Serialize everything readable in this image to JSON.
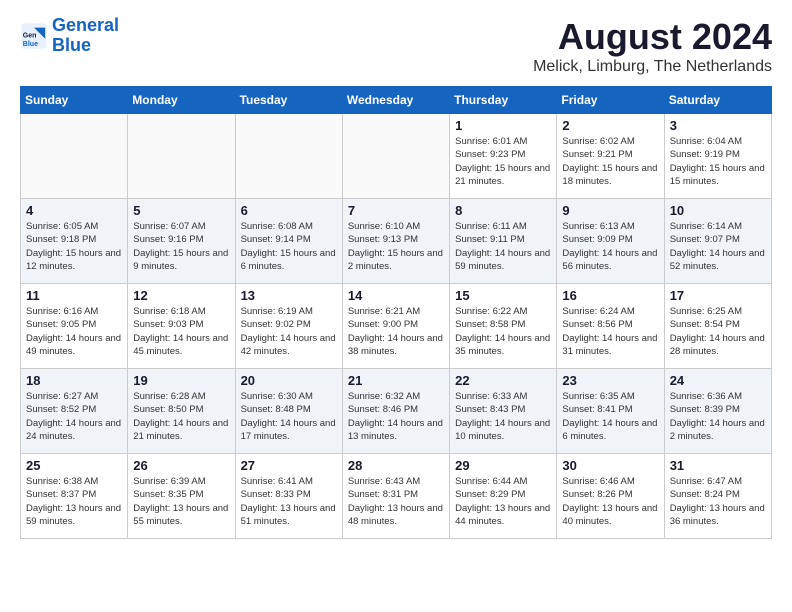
{
  "header": {
    "logo_line1": "General",
    "logo_line2": "Blue",
    "title": "August 2024",
    "subtitle": "Melick, Limburg, The Netherlands"
  },
  "weekdays": [
    "Sunday",
    "Monday",
    "Tuesday",
    "Wednesday",
    "Thursday",
    "Friday",
    "Saturday"
  ],
  "weeks": [
    [
      {
        "day": "",
        "info": ""
      },
      {
        "day": "",
        "info": ""
      },
      {
        "day": "",
        "info": ""
      },
      {
        "day": "",
        "info": ""
      },
      {
        "day": "1",
        "info": "Sunrise: 6:01 AM\nSunset: 9:23 PM\nDaylight: 15 hours\nand 21 minutes."
      },
      {
        "day": "2",
        "info": "Sunrise: 6:02 AM\nSunset: 9:21 PM\nDaylight: 15 hours\nand 18 minutes."
      },
      {
        "day": "3",
        "info": "Sunrise: 6:04 AM\nSunset: 9:19 PM\nDaylight: 15 hours\nand 15 minutes."
      }
    ],
    [
      {
        "day": "4",
        "info": "Sunrise: 6:05 AM\nSunset: 9:18 PM\nDaylight: 15 hours\nand 12 minutes."
      },
      {
        "day": "5",
        "info": "Sunrise: 6:07 AM\nSunset: 9:16 PM\nDaylight: 15 hours\nand 9 minutes."
      },
      {
        "day": "6",
        "info": "Sunrise: 6:08 AM\nSunset: 9:14 PM\nDaylight: 15 hours\nand 6 minutes."
      },
      {
        "day": "7",
        "info": "Sunrise: 6:10 AM\nSunset: 9:13 PM\nDaylight: 15 hours\nand 2 minutes."
      },
      {
        "day": "8",
        "info": "Sunrise: 6:11 AM\nSunset: 9:11 PM\nDaylight: 14 hours\nand 59 minutes."
      },
      {
        "day": "9",
        "info": "Sunrise: 6:13 AM\nSunset: 9:09 PM\nDaylight: 14 hours\nand 56 minutes."
      },
      {
        "day": "10",
        "info": "Sunrise: 6:14 AM\nSunset: 9:07 PM\nDaylight: 14 hours\nand 52 minutes."
      }
    ],
    [
      {
        "day": "11",
        "info": "Sunrise: 6:16 AM\nSunset: 9:05 PM\nDaylight: 14 hours\nand 49 minutes."
      },
      {
        "day": "12",
        "info": "Sunrise: 6:18 AM\nSunset: 9:03 PM\nDaylight: 14 hours\nand 45 minutes."
      },
      {
        "day": "13",
        "info": "Sunrise: 6:19 AM\nSunset: 9:02 PM\nDaylight: 14 hours\nand 42 minutes."
      },
      {
        "day": "14",
        "info": "Sunrise: 6:21 AM\nSunset: 9:00 PM\nDaylight: 14 hours\nand 38 minutes."
      },
      {
        "day": "15",
        "info": "Sunrise: 6:22 AM\nSunset: 8:58 PM\nDaylight: 14 hours\nand 35 minutes."
      },
      {
        "day": "16",
        "info": "Sunrise: 6:24 AM\nSunset: 8:56 PM\nDaylight: 14 hours\nand 31 minutes."
      },
      {
        "day": "17",
        "info": "Sunrise: 6:25 AM\nSunset: 8:54 PM\nDaylight: 14 hours\nand 28 minutes."
      }
    ],
    [
      {
        "day": "18",
        "info": "Sunrise: 6:27 AM\nSunset: 8:52 PM\nDaylight: 14 hours\nand 24 minutes."
      },
      {
        "day": "19",
        "info": "Sunrise: 6:28 AM\nSunset: 8:50 PM\nDaylight: 14 hours\nand 21 minutes."
      },
      {
        "day": "20",
        "info": "Sunrise: 6:30 AM\nSunset: 8:48 PM\nDaylight: 14 hours\nand 17 minutes."
      },
      {
        "day": "21",
        "info": "Sunrise: 6:32 AM\nSunset: 8:46 PM\nDaylight: 14 hours\nand 13 minutes."
      },
      {
        "day": "22",
        "info": "Sunrise: 6:33 AM\nSunset: 8:43 PM\nDaylight: 14 hours\nand 10 minutes."
      },
      {
        "day": "23",
        "info": "Sunrise: 6:35 AM\nSunset: 8:41 PM\nDaylight: 14 hours\nand 6 minutes."
      },
      {
        "day": "24",
        "info": "Sunrise: 6:36 AM\nSunset: 8:39 PM\nDaylight: 14 hours\nand 2 minutes."
      }
    ],
    [
      {
        "day": "25",
        "info": "Sunrise: 6:38 AM\nSunset: 8:37 PM\nDaylight: 13 hours\nand 59 minutes."
      },
      {
        "day": "26",
        "info": "Sunrise: 6:39 AM\nSunset: 8:35 PM\nDaylight: 13 hours\nand 55 minutes."
      },
      {
        "day": "27",
        "info": "Sunrise: 6:41 AM\nSunset: 8:33 PM\nDaylight: 13 hours\nand 51 minutes."
      },
      {
        "day": "28",
        "info": "Sunrise: 6:43 AM\nSunset: 8:31 PM\nDaylight: 13 hours\nand 48 minutes."
      },
      {
        "day": "29",
        "info": "Sunrise: 6:44 AM\nSunset: 8:29 PM\nDaylight: 13 hours\nand 44 minutes."
      },
      {
        "day": "30",
        "info": "Sunrise: 6:46 AM\nSunset: 8:26 PM\nDaylight: 13 hours\nand 40 minutes."
      },
      {
        "day": "31",
        "info": "Sunrise: 6:47 AM\nSunset: 8:24 PM\nDaylight: 13 hours\nand 36 minutes."
      }
    ]
  ]
}
